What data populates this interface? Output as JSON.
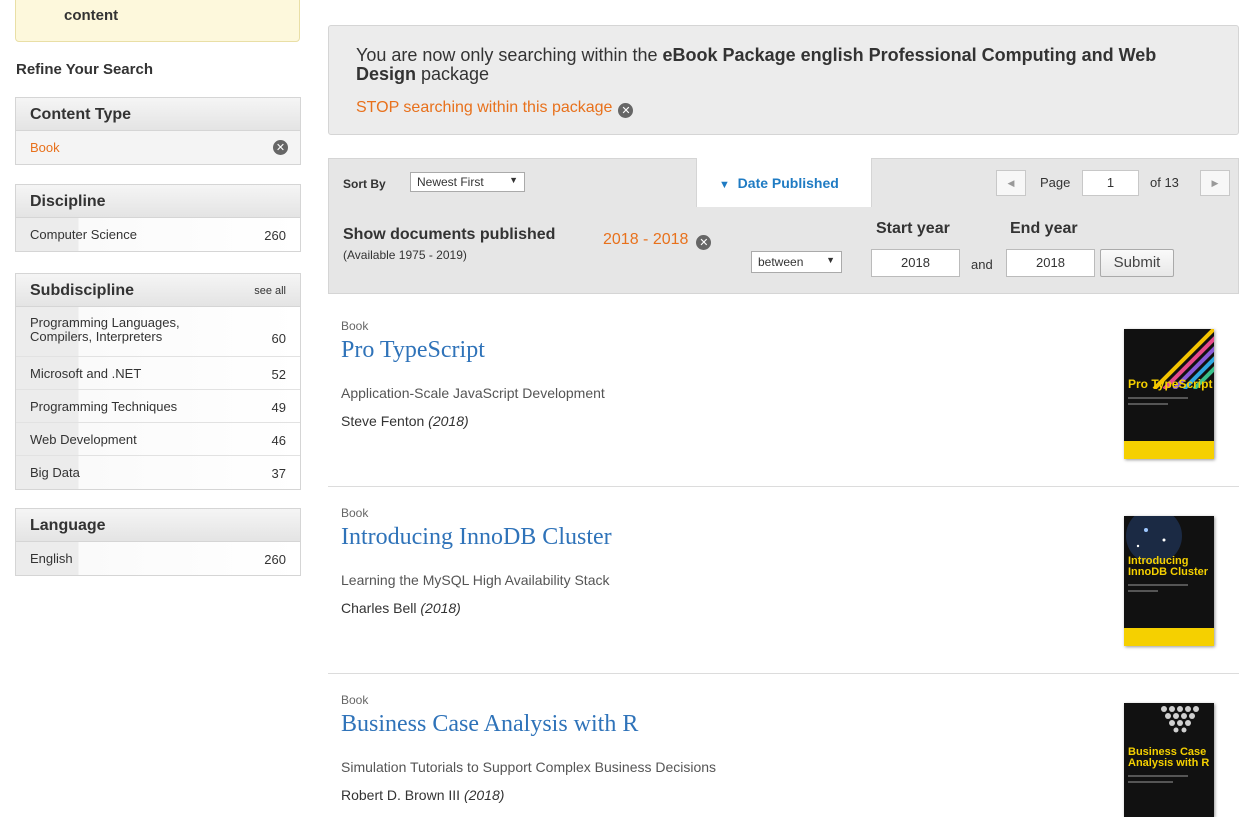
{
  "sidebar": {
    "notice_text": "content",
    "refine_title": "Refine Your Search",
    "content_type": {
      "title": "Content Type",
      "items": [
        {
          "label": "Book",
          "remove_icon": "close-circle-icon"
        }
      ]
    },
    "discipline": {
      "title": "Discipline",
      "items": [
        {
          "label": "Computer Science",
          "count": "260"
        }
      ]
    },
    "subdiscipline": {
      "title": "Subdiscipline",
      "see_all": "see all",
      "items": [
        {
          "label": "Programming Languages, Compilers, Interpreters",
          "count": "60"
        },
        {
          "label": "Microsoft and .NET",
          "count": "52"
        },
        {
          "label": "Programming Techniques",
          "count": "49"
        },
        {
          "label": "Web Development",
          "count": "46"
        },
        {
          "label": "Big Data",
          "count": "37"
        }
      ]
    },
    "language": {
      "title": "Language",
      "items": [
        {
          "label": "English",
          "count": "260"
        }
      ]
    }
  },
  "package_banner": {
    "prefix": "You are now only searching within the ",
    "package_name": "eBook Package english Professional Computing and Web Design",
    "suffix": " package",
    "stop_link": "STOP searching within this package"
  },
  "sort": {
    "label": "Sort By",
    "selected": "Newest First",
    "date_tab": "Date Published",
    "page_label": "Page",
    "page_value": "1",
    "of_label": "of 13"
  },
  "date_filter": {
    "title": "Show documents published",
    "available": "(Available 1975 - 2019)",
    "range": "2018 - 2018",
    "mode": "between",
    "start_label": "Start year",
    "end_label": "End year",
    "start_value": "2018",
    "and_label": "and",
    "end_value": "2018",
    "submit": "Submit"
  },
  "results": [
    {
      "type": "Book",
      "title": "Pro TypeScript",
      "subtitle": "Application-Scale JavaScript Development",
      "author": "Steve Fenton",
      "year": "(2018)",
      "cover_title": "Pro TypeScript"
    },
    {
      "type": "Book",
      "title": "Introducing InnoDB Cluster",
      "subtitle": "Learning the MySQL High Availability Stack",
      "author": "Charles Bell",
      "year": "(2018)",
      "cover_title": "Introducing InnoDB Cluster"
    },
    {
      "type": "Book",
      "title": "Business Case Analysis with R",
      "subtitle": "Simulation Tutorials to Support Complex Business Decisions",
      "author": "Robert D. Brown III",
      "year": "(2018)",
      "cover_title": "Business Case Analysis with R"
    }
  ],
  "colors": {
    "accent_orange": "#e8711c",
    "link_blue": "#2f73b9",
    "tab_blue": "#1f7bc3",
    "cover_yellow": "#f5d000"
  }
}
